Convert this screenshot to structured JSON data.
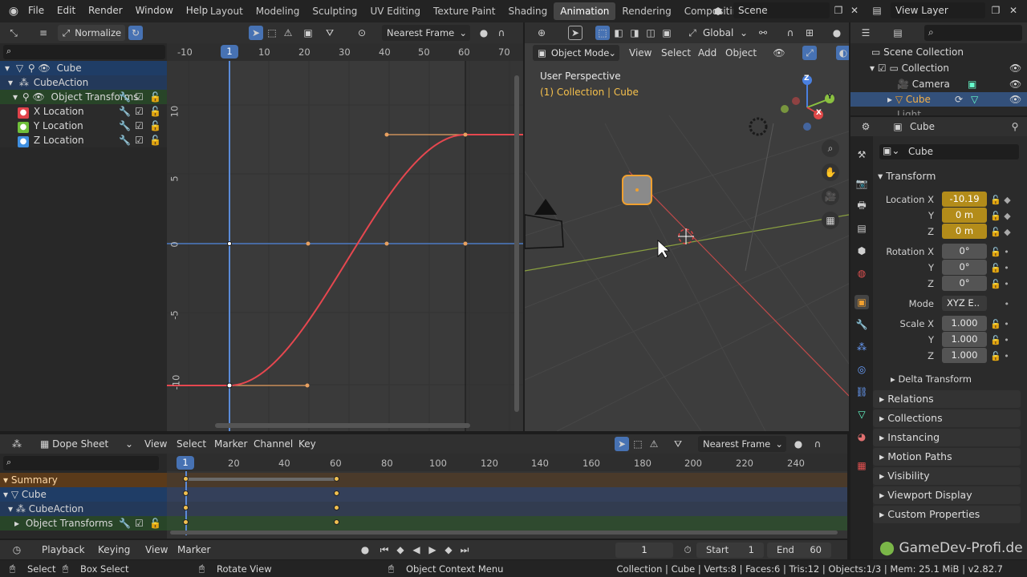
{
  "topbar": {
    "menus": [
      "File",
      "Edit",
      "Render",
      "Window",
      "Help"
    ],
    "workspaces": [
      "Layout",
      "Modeling",
      "Sculpting",
      "UV Editing",
      "Texture Paint",
      "Shading",
      "Animation",
      "Rendering",
      "Compositing"
    ],
    "active_workspace": "Animation",
    "scene": "Scene",
    "view_layer": "View Layer"
  },
  "graph_editor": {
    "normalize_label": "Normalize",
    "snap_mode": "Nearest Frame",
    "frame_ticks": [
      "-10",
      "1",
      "10",
      "20",
      "30",
      "40",
      "50",
      "60",
      "70"
    ],
    "value_ticks": [
      "10",
      "5",
      "0",
      "-5",
      "-10"
    ],
    "channels": [
      {
        "label": "Cube",
        "type": "object"
      },
      {
        "label": "CubeAction",
        "type": "action"
      },
      {
        "label": "Object Transforms",
        "type": "group"
      },
      {
        "label": "X Location",
        "type": "fcurve",
        "color": "#e0424a"
      },
      {
        "label": "Y Location",
        "type": "fcurve",
        "color": "#6fbf3a"
      },
      {
        "label": "Z Location",
        "type": "fcurve",
        "color": "#3f8fe0"
      }
    ]
  },
  "viewport": {
    "mode": "Object Mode",
    "menus": [
      "View",
      "Select",
      "Add",
      "Object"
    ],
    "orientation": "Global",
    "perspective_label": "User Perspective",
    "collection_label": "(1) Collection | Cube",
    "gizmo_axes": [
      "Z",
      "Y",
      "X"
    ]
  },
  "outliner": {
    "search_placeholder": "",
    "items": [
      "Scene Collection",
      "Collection",
      "Camera",
      "Cube",
      "Light"
    ]
  },
  "properties": {
    "object_name": "Cube",
    "data_name": "Cube",
    "transform_label": "Transform",
    "location": {
      "label": "Location X",
      "x": "-10.19",
      "y": "0 m",
      "z": "0 m"
    },
    "rotation": {
      "label": "Rotation X",
      "x": "0°",
      "y": "0°",
      "z": "0°"
    },
    "mode_label": "Mode",
    "mode_value": "XYZ E..",
    "scale": {
      "label": "Scale X",
      "x": "1.000",
      "y": "1.000",
      "z": "1.000"
    },
    "axis_y": "Y",
    "axis_z": "Z",
    "delta": "Delta Transform",
    "panels": [
      "Relations",
      "Collections",
      "Instancing",
      "Motion Paths",
      "Visibility",
      "Viewport Display",
      "Custom Properties"
    ],
    "watermark": "GameDev-Profi.de"
  },
  "dopesheet": {
    "mode": "Dope Sheet",
    "menus": [
      "View",
      "Select",
      "Marker",
      "Channel",
      "Key"
    ],
    "snap_mode": "Nearest Frame",
    "frame_ticks": [
      "1",
      "20",
      "40",
      "60",
      "80",
      "100",
      "120",
      "140",
      "160",
      "180",
      "200",
      "220",
      "240"
    ],
    "channels": [
      "Summary",
      "Cube",
      "CubeAction",
      "Object Transforms"
    ],
    "keyframes": [
      1,
      60
    ]
  },
  "timeline": {
    "menus": [
      "Playback",
      "Keying",
      "View",
      "Marker"
    ],
    "current_frame": "1",
    "start_label": "Start",
    "start": "1",
    "end_label": "End",
    "end": "60"
  },
  "statusbar": {
    "select": "Select",
    "box_select": "Box Select",
    "rotate_view": "Rotate View",
    "context_menu": "Object Context Menu",
    "stats": "Collection | Cube | Verts:8 | Faces:6 | Tris:12 | Objects:1/3 | Mem: 25.1 MiB | v2.82.7"
  }
}
